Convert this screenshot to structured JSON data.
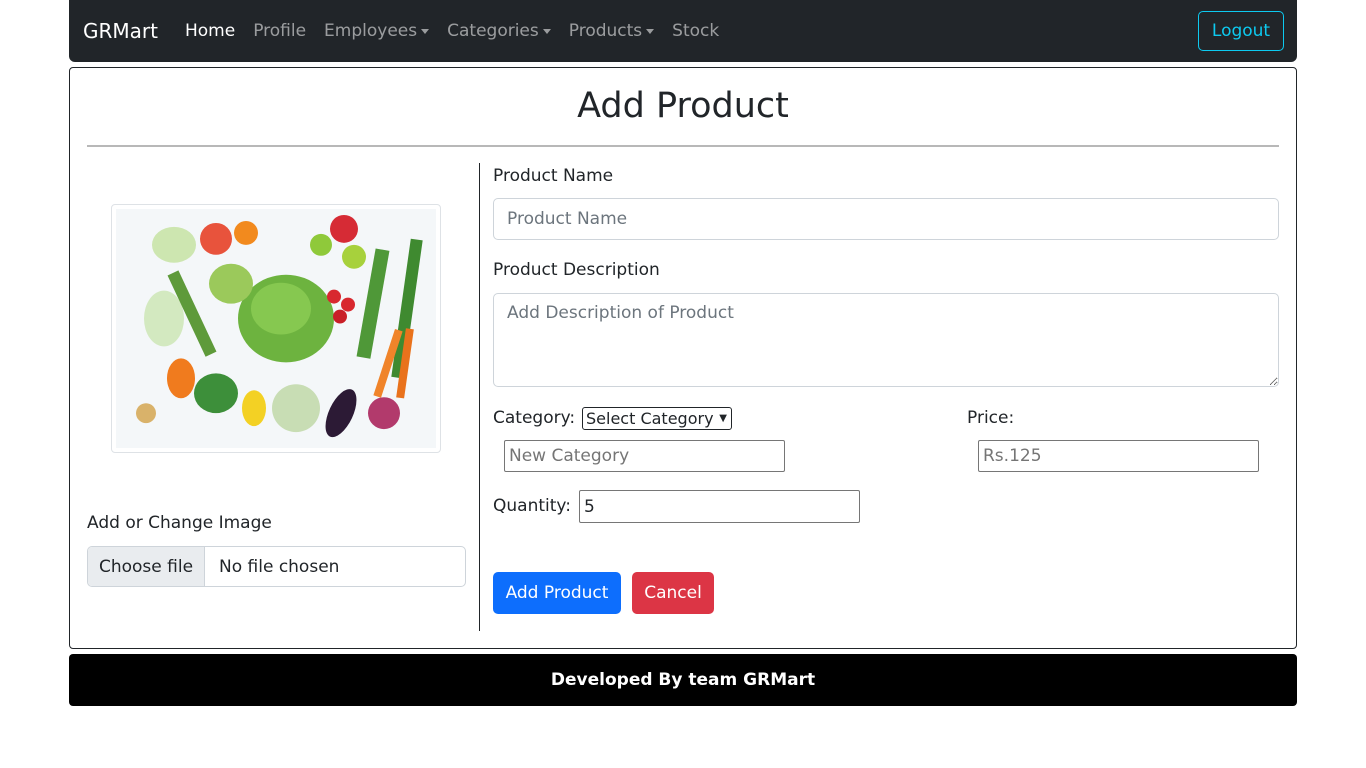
{
  "navbar": {
    "brand": "GRMart",
    "items": [
      {
        "label": "Home"
      },
      {
        "label": "Profile"
      },
      {
        "label": "Employees"
      },
      {
        "label": "Categories"
      },
      {
        "label": "Products"
      },
      {
        "label": "Stock"
      }
    ],
    "logout_label": "Logout"
  },
  "page": {
    "title": "Add Product"
  },
  "image_panel": {
    "image_alt": "assorted vegetables and fruits",
    "add_image_label": "Add or Change Image",
    "choose_file_label": "Choose file",
    "file_status": "No file chosen"
  },
  "form": {
    "product_name_label": "Product Name",
    "product_name_placeholder": "Product Name",
    "product_description_label": "Product Description",
    "product_description_placeholder": "Add Description of Product",
    "category_label": "Category:",
    "category_selected": "Select Category",
    "new_category_placeholder": "New Category",
    "price_label": "Price:",
    "price_placeholder": "Rs.125",
    "quantity_label": "Quantity:",
    "quantity_value": "5",
    "add_button_label": "Add Product",
    "cancel_button_label": "Cancel"
  },
  "footer": {
    "text": "Developed By team GRMart"
  },
  "colors": {
    "navbar_bg": "#212529",
    "primary": "#0d6efd",
    "danger": "#dc3545",
    "info": "#0dcaf0",
    "footer_bg": "#000000"
  }
}
